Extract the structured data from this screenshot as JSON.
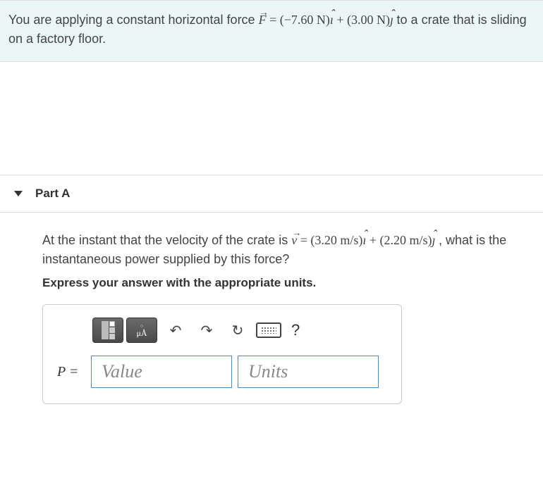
{
  "problem": {
    "prefix": "You are applying a constant horizontal force ",
    "force_symbol": "F",
    "force_eq": " = (−7.60 N)",
    "ihat": "ı",
    "plus": " + (3.00 N)",
    "jhat": "ȷ",
    "suffix": " to a crate that is sliding on a factory floor."
  },
  "part": {
    "label": "Part A",
    "question_prefix": "At the instant that the velocity of the crate is ",
    "vel_symbol": "v",
    "vel_eq": " = (3.20 m/s)",
    "ihat": "ı",
    "plus": " + (2.20 m/s)",
    "jhat": "ȷ",
    "question_suffix": ", what is the instantaneous power supplied by this force?",
    "instruction": "Express your answer with the appropriate units."
  },
  "answer": {
    "var_label": "P =",
    "value_placeholder": "Value",
    "units_placeholder": "Units",
    "help_label": "?"
  },
  "toolbar": {
    "undo": "↶",
    "redo": "↷",
    "reset": "↻",
    "mu_a": "μÅ"
  }
}
